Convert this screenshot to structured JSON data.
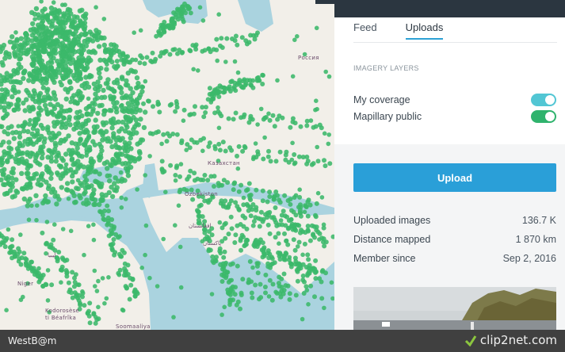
{
  "map": {
    "labels": {
      "russia": "Россия",
      "kazakhstan": "Казахстан",
      "uzbekistan": "Ozbekiston",
      "afghanistan": "افغانستان",
      "pakistan": "پاکستان",
      "libya": "ليبيا",
      "niger": "Niger",
      "cote_divoire": "Kodorosèse\nti Béafrîka",
      "somalia": "Soomaaliya"
    },
    "coverage_color": "#3bb86a",
    "water_color": "#aad3df",
    "land_color": "#f2efe9"
  },
  "panel": {
    "tabs": [
      {
        "label": "Feed",
        "active": false
      },
      {
        "label": "Uploads",
        "active": true
      }
    ],
    "imagery_layers_title": "IMAGERY LAYERS",
    "layers": [
      {
        "label": "My coverage",
        "enabled": true,
        "color": "#52c6d4"
      },
      {
        "label": "Mapillary public",
        "enabled": true,
        "color": "#2fb36d"
      }
    ],
    "upload_label": "Upload",
    "stats": [
      {
        "label": "Uploaded images",
        "value": "136.7 K"
      },
      {
        "label": "Distance mapped",
        "value": "1 870 km"
      },
      {
        "label": "Member since",
        "value": "Sep 2, 2016"
      }
    ]
  },
  "bottombar": {
    "left_text": "WestB@m",
    "right_text": "clip2net.com"
  }
}
